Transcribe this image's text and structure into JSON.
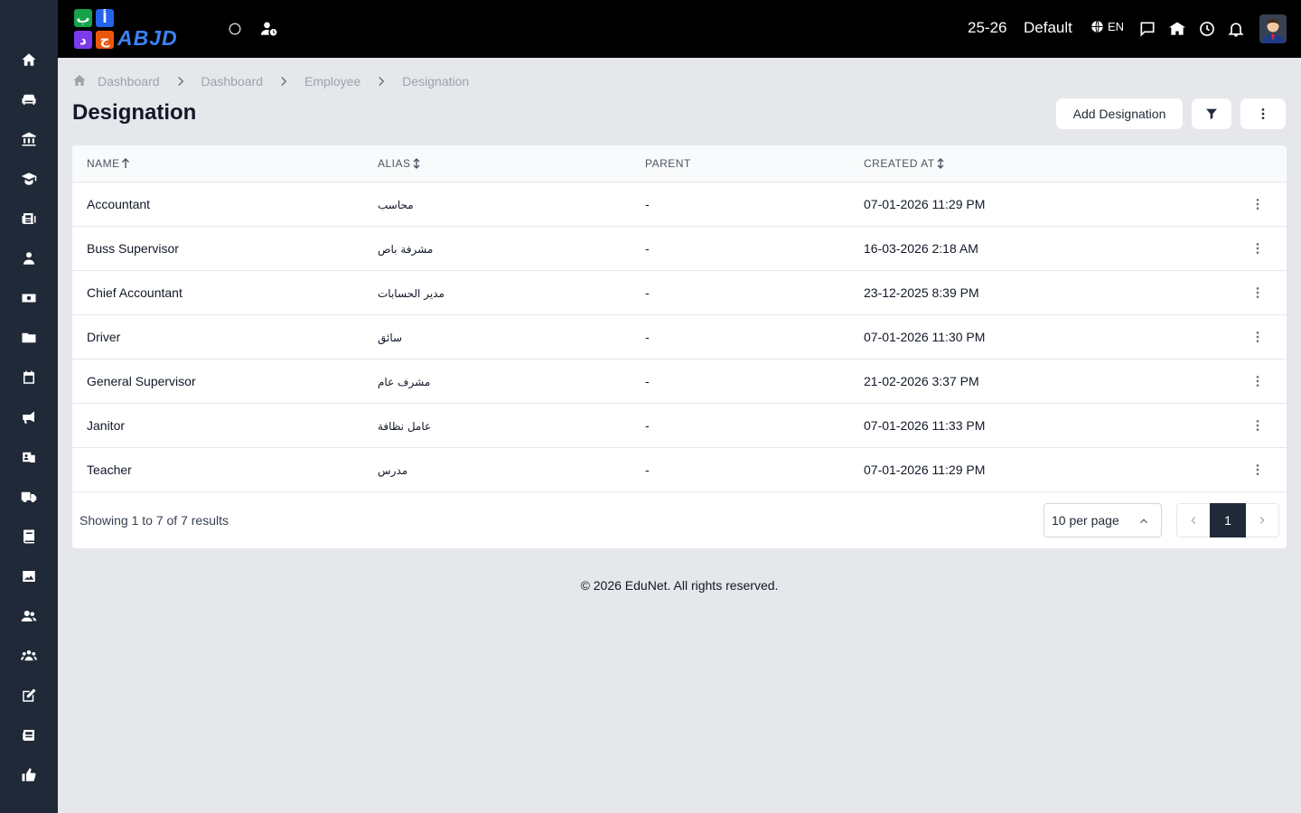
{
  "topbar": {
    "logo_letters": [
      "ب",
      "أ",
      "د",
      "ج"
    ],
    "logo_word": "ABJD",
    "year": "25-26",
    "profile": "Default",
    "lang": "EN"
  },
  "breadcrumb": [
    "Dashboard",
    "Dashboard",
    "Employee",
    "Designation"
  ],
  "page": {
    "title": "Designation",
    "add_label": "Add Designation"
  },
  "table": {
    "columns": [
      "NAME",
      "ALIAS",
      "PARENT",
      "CREATED AT"
    ],
    "rows": [
      {
        "name": "Accountant",
        "alias": "محاسب",
        "parent": "-",
        "created": "07-01-2026 11:29 PM"
      },
      {
        "name": "Buss Supervisor",
        "alias": "مشرفة باص",
        "parent": "-",
        "created": "16-03-2026 2:18 AM"
      },
      {
        "name": "Chief Accountant",
        "alias": "مدير الحسابات",
        "parent": "-",
        "created": "23-12-2025 8:39 PM"
      },
      {
        "name": "Driver",
        "alias": "سائق",
        "parent": "-",
        "created": "07-01-2026 11:30 PM"
      },
      {
        "name": "General Supervisor",
        "alias": "مشرف عام",
        "parent": "-",
        "created": "21-02-2026 3:37 PM"
      },
      {
        "name": "Janitor",
        "alias": "عامل نظافة",
        "parent": "-",
        "created": "07-01-2026 11:33 PM"
      },
      {
        "name": "Teacher",
        "alias": "مدرس",
        "parent": "-",
        "created": "07-01-2026 11:29 PM"
      }
    ]
  },
  "pagination": {
    "summary": "Showing 1 to 7 of 7 results",
    "per_page": "10 per page",
    "current_page": "1"
  },
  "footer": "© 2026 EduNet. All rights reserved.",
  "colors": {
    "sidebar": "#1f2937",
    "topbar": "#000000",
    "page_bg": "#e5e7eb",
    "accent": "#1f2937"
  },
  "icons": {
    "sidebar": [
      "home-icon",
      "sofa-icon",
      "bank-icon",
      "graduate-icon",
      "newspaper-icon",
      "user-tie-icon",
      "money-icon",
      "folder-icon",
      "calendar-icon",
      "megaphone-icon",
      "id-card-icon",
      "truck-icon",
      "book-icon",
      "image-icon",
      "users-icon",
      "group-icon",
      "edit-icon",
      "news-icon",
      "thumbs-up-icon"
    ]
  }
}
